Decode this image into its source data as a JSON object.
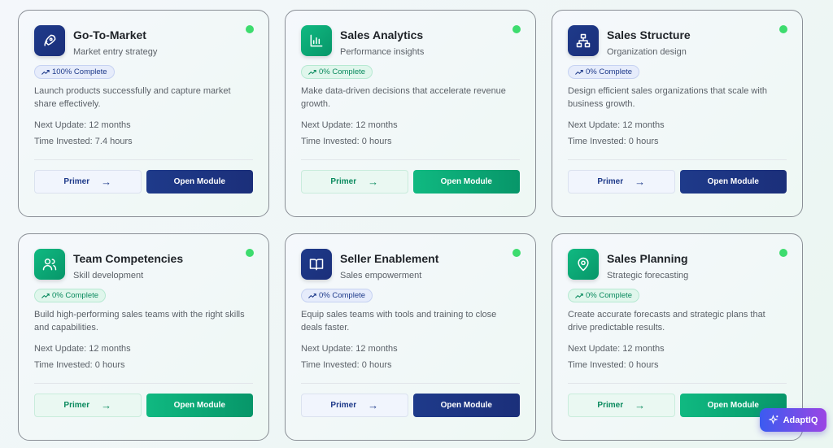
{
  "modules": [
    {
      "title": "Go-To-Market",
      "subtitle": "Market entry strategy",
      "badge": "100% Complete",
      "description": "Launch products successfully and capture market share effectively.",
      "next_update": "Next Update: 12 months",
      "time_invested": "Time Invested: 7.4 hours",
      "primer": "Primer",
      "open": "Open Module",
      "theme": "blue",
      "icon": "rocket-icon"
    },
    {
      "title": "Sales Analytics",
      "subtitle": "Performance insights",
      "badge": "0% Complete",
      "description": "Make data-driven decisions that accelerate revenue growth.",
      "next_update": "Next Update: 12 months",
      "time_invested": "Time Invested: 0 hours",
      "primer": "Primer",
      "open": "Open Module",
      "theme": "green",
      "icon": "bar-chart-icon"
    },
    {
      "title": "Sales Structure",
      "subtitle": "Organization design",
      "badge": "0% Complete",
      "description": "Design efficient sales organizations that scale with business growth.",
      "next_update": "Next Update: 12 months",
      "time_invested": "Time Invested: 0 hours",
      "primer": "Primer",
      "open": "Open Module",
      "theme": "blue",
      "icon": "org-chart-icon"
    },
    {
      "title": "Team Competencies",
      "subtitle": "Skill development",
      "badge": "0% Complete",
      "description": "Build high-performing sales teams with the right skills and capabilities.",
      "next_update": "Next Update: 12 months",
      "time_invested": "Time Invested: 0 hours",
      "primer": "Primer",
      "open": "Open Module",
      "theme": "green",
      "icon": "users-icon"
    },
    {
      "title": "Seller Enablement",
      "subtitle": "Sales empowerment",
      "badge": "0% Complete",
      "description": "Equip sales teams with tools and training to close deals faster.",
      "next_update": "Next Update: 12 months",
      "time_invested": "Time Invested: 0 hours",
      "primer": "Primer",
      "open": "Open Module",
      "theme": "blue",
      "icon": "book-open-icon"
    },
    {
      "title": "Sales Planning",
      "subtitle": "Strategic forecasting",
      "badge": "0% Complete",
      "description": "Create accurate forecasts and strategic plans that drive predictable results.",
      "next_update": "Next Update: 12 months",
      "time_invested": "Time Invested: 0 hours",
      "primer": "Primer",
      "open": "Open Module",
      "theme": "green",
      "icon": "map-pin-icon"
    }
  ],
  "assistant": {
    "label": "AdaptIQ",
    "icon": "sparkles-icon"
  },
  "colors": {
    "blue": "#1e3a8a",
    "green": "#10b981",
    "status": "#3ddc6e"
  }
}
